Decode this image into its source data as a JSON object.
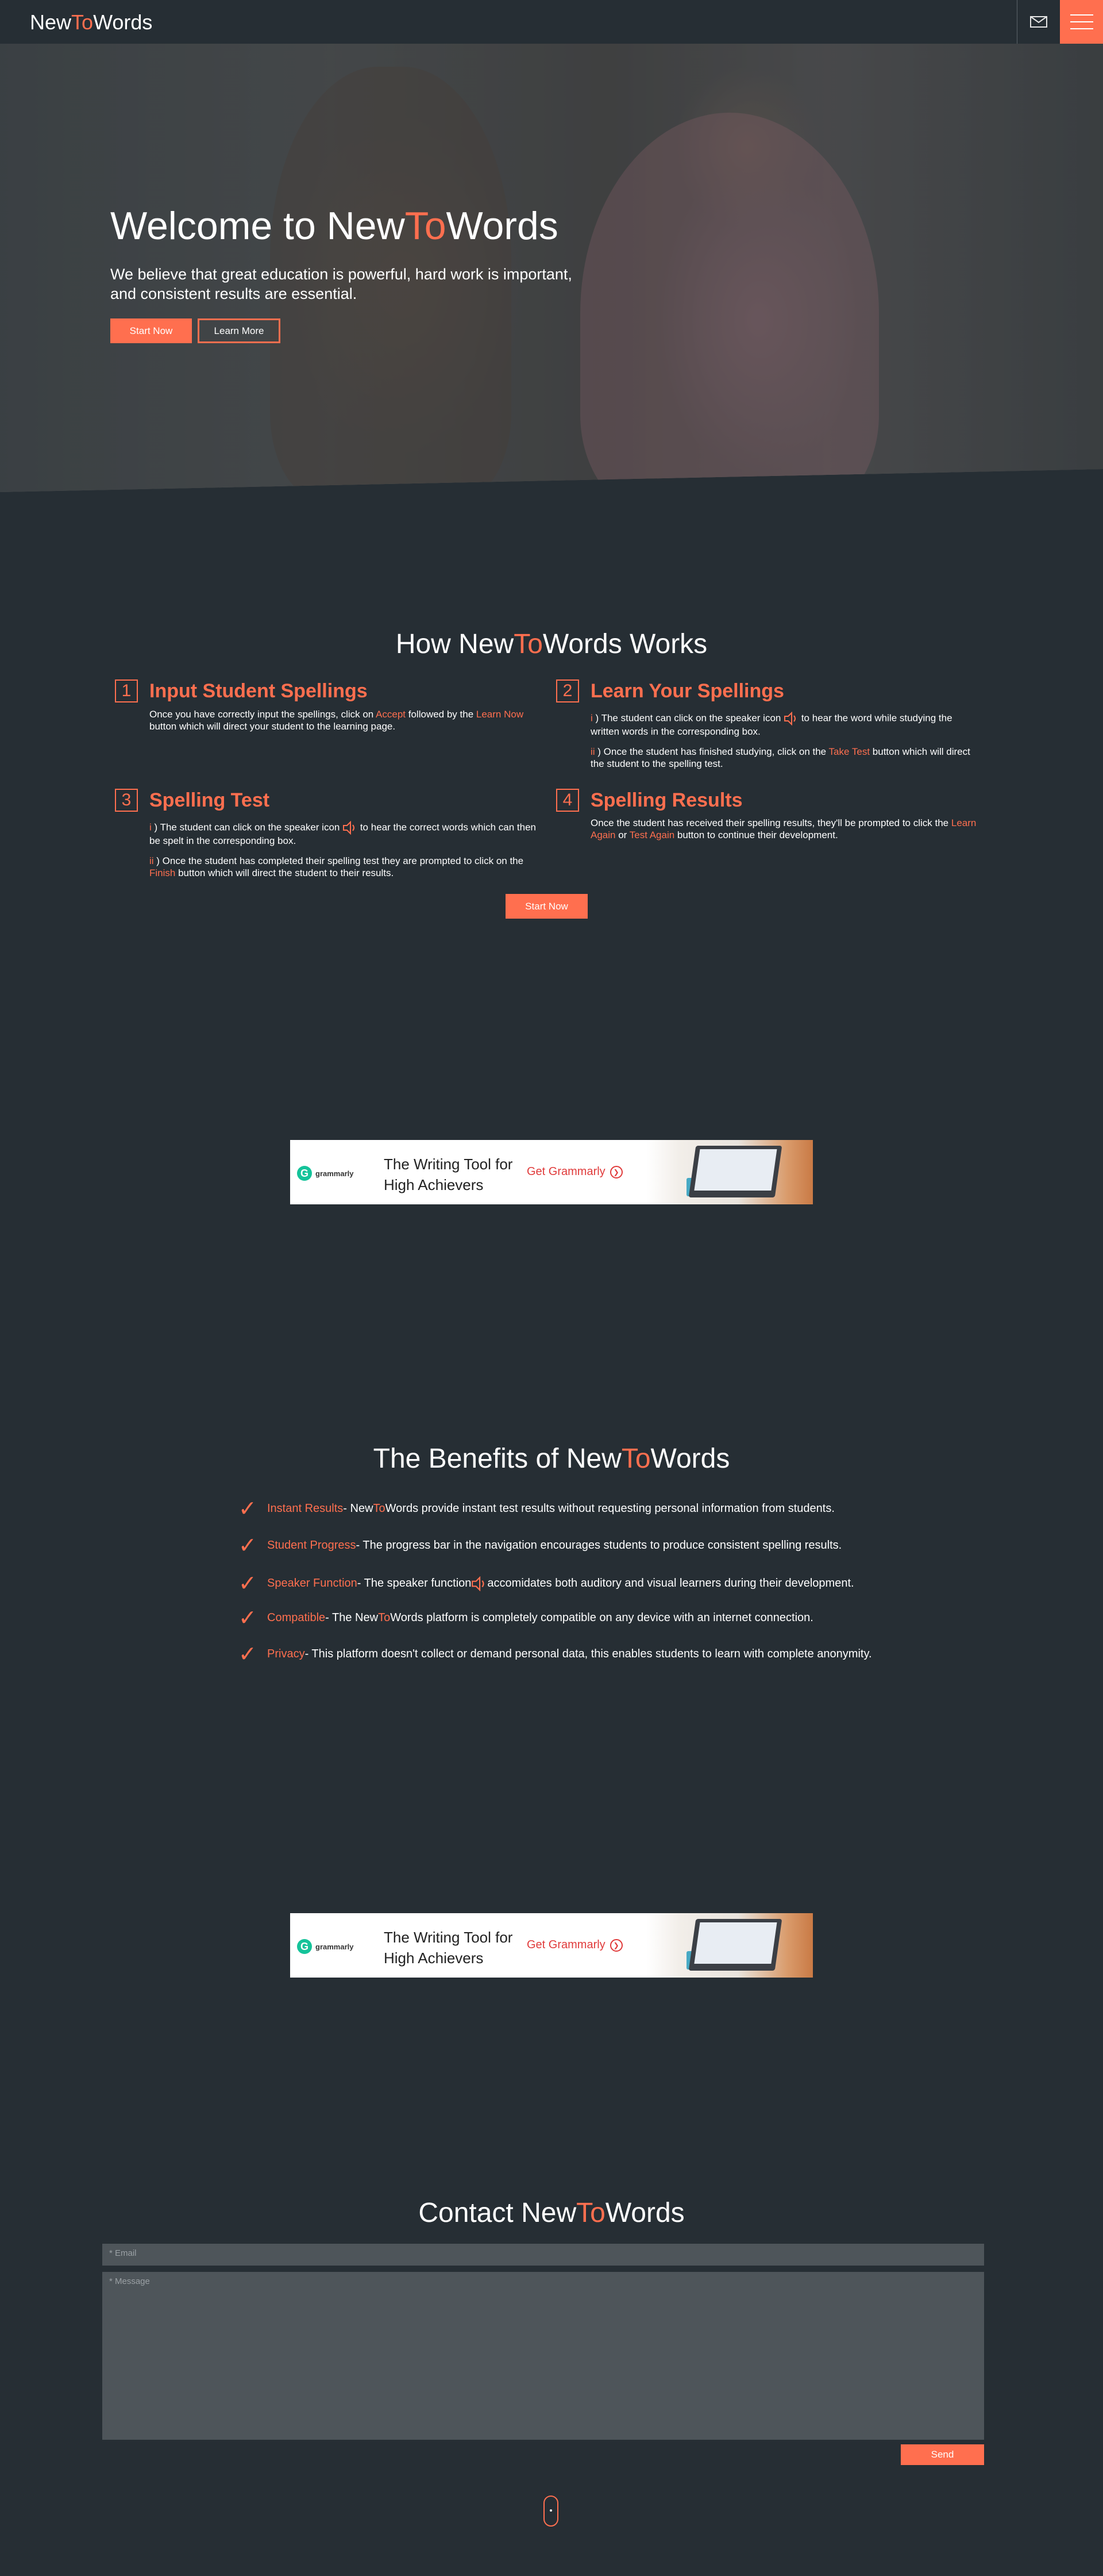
{
  "header": {
    "logo": {
      "pre": "New",
      "mid": "To",
      "post": "Words"
    },
    "mail_icon": "envelope-icon",
    "menu_icon": "hamburger-icon"
  },
  "colors": {
    "accent": "#ff6f4f",
    "background": "#262e34",
    "field": "#4e555a"
  },
  "hero": {
    "title_pre": "Welcome to New",
    "title_mid": "To",
    "title_post": "Words",
    "subtitle": "We believe that great education is powerful, hard work is important, and consistent results are essential.",
    "start_label": "Start Now",
    "learn_label": "Learn More"
  },
  "how": {
    "title_pre": "How New",
    "title_mid": "To",
    "title_post": "Words Works",
    "steps": [
      {
        "num": "1",
        "title": "Input Student Spellings",
        "p1_a": "Once you have correctly input the spellings, click on ",
        "p1_b": "Accept",
        "p1_c": " followed by the ",
        "p1_d": "Learn Now",
        "p1_e": " button which will direct your student to the learning page."
      },
      {
        "num": "2",
        "title": "Learn Your Spellings",
        "p1_a": "i",
        "p1_b": " ) The student can click on the speaker icon ",
        "p1_c": " to hear the word while studying the written words in the corresponding box.",
        "p2_a": "ii",
        "p2_b": " ) Once the student has finished studying, click on the ",
        "p2_c": "Take Test",
        "p2_d": " button which will direct the student to the spelling test."
      },
      {
        "num": "3",
        "title": "Spelling Test",
        "p1_a": "i",
        "p1_b": " ) The student can click on the speaker icon ",
        "p1_c": " to hear the correct words which can then be spelt in the corresponding box.",
        "p2_a": "ii",
        "p2_b": " ) Once the student has completed their spelling test they are prompted to click on the ",
        "p2_c": "Finish",
        "p2_d": " button which will direct the student to their results."
      },
      {
        "num": "4",
        "title": "Spelling Results",
        "p1_a": "Once the student has received their spelling results, they'll be prompted to click the ",
        "p1_b": "Learn Again",
        "p1_c": " or ",
        "p1_d": "Test Again",
        "p1_e": " button to continue their development."
      }
    ],
    "start_label": "Start Now"
  },
  "ad": {
    "brand": "grammarly",
    "brand_letter": "G",
    "headline": "The Writing Tool for High Achievers",
    "cta": "Get Grammarly"
  },
  "benefits": {
    "title_pre": "The Benefits of New",
    "title_mid": "To",
    "title_post": "Words",
    "items": [
      {
        "label": "Instant Results",
        "pre": " - New",
        "mid": "To",
        "post": "Words provide instant test results without requesting personal information from students."
      },
      {
        "label": "Student Progress",
        "text": " - The progress bar in the navigation encourages students to produce consistent spelling results."
      },
      {
        "label": "Speaker Function",
        "pre": " - The speaker function ",
        "post": " accomidates both auditory and visual learners during their development."
      },
      {
        "label": "Compatible",
        "pre": " - The New",
        "mid": "To",
        "post": "Words platform is completely compatible on any device with an internet connection."
      },
      {
        "label": "Privacy",
        "text": " - This platform doesn't collect or demand personal data, this enables students to learn with complete anonymity."
      }
    ]
  },
  "contact": {
    "title_pre": "Contact New",
    "title_mid": "To",
    "title_post": "Words",
    "email_placeholder": "* Email",
    "message_placeholder": "* Message",
    "send_label": "Send"
  }
}
